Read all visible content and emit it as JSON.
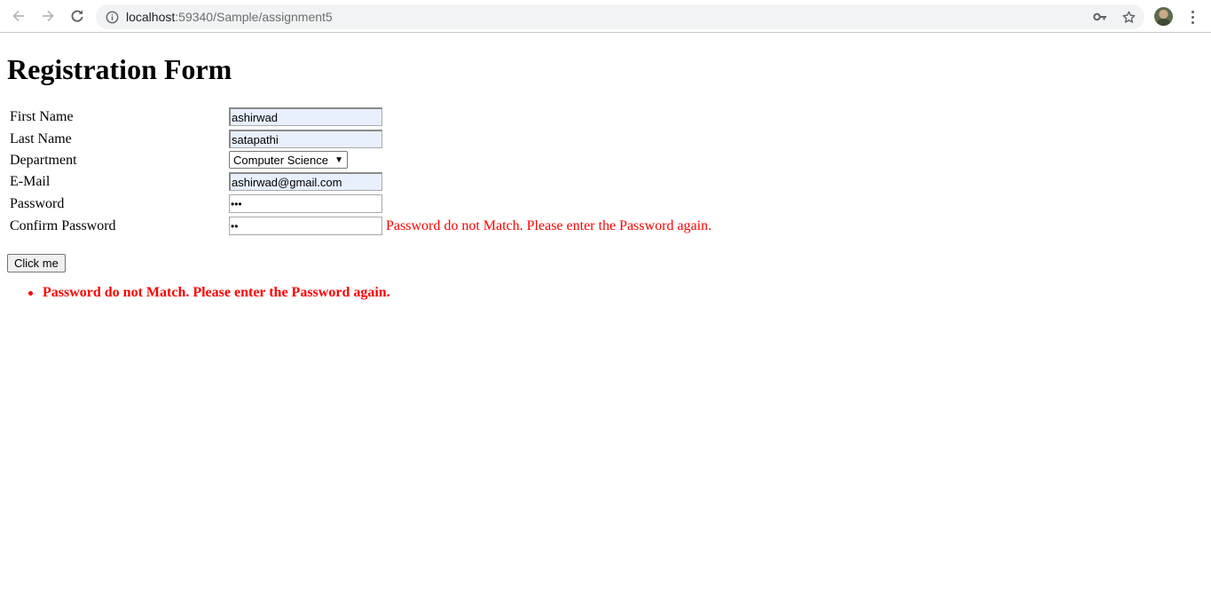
{
  "browser": {
    "url_host": "localhost",
    "url_path": ":59340/Sample/assignment5",
    "icons": {
      "back": "arrow-left-icon",
      "forward": "arrow-right-icon",
      "reload": "reload-icon",
      "site_info": "info-icon",
      "password_key": "key-icon",
      "bookmark": "star-icon",
      "profile": "avatar",
      "menu": "more-vertical-icon"
    }
  },
  "form": {
    "title": "Registration Form",
    "fields": {
      "first_name": {
        "label": "First Name",
        "value": "ashirwad"
      },
      "last_name": {
        "label": "Last Name",
        "value": "satapathi"
      },
      "department": {
        "label": "Department",
        "value": "Computer Science"
      },
      "email": {
        "label": "E-Mail",
        "value": "ashirwad@gmail.com"
      },
      "password": {
        "label": "Password",
        "value": "•••"
      },
      "confirm_password": {
        "label": "Confirm Password",
        "value": "••"
      }
    },
    "confirm_password_error": "Password do not Match. Please enter the Password again.",
    "submit_label": "Click me"
  },
  "validation_summary": {
    "items": [
      "Password do not Match. Please enter the Password again."
    ]
  },
  "colors": {
    "error": "#ff0000",
    "autofill_bg": "#e8f0fe",
    "omnibox_bg": "#f1f3f4"
  }
}
